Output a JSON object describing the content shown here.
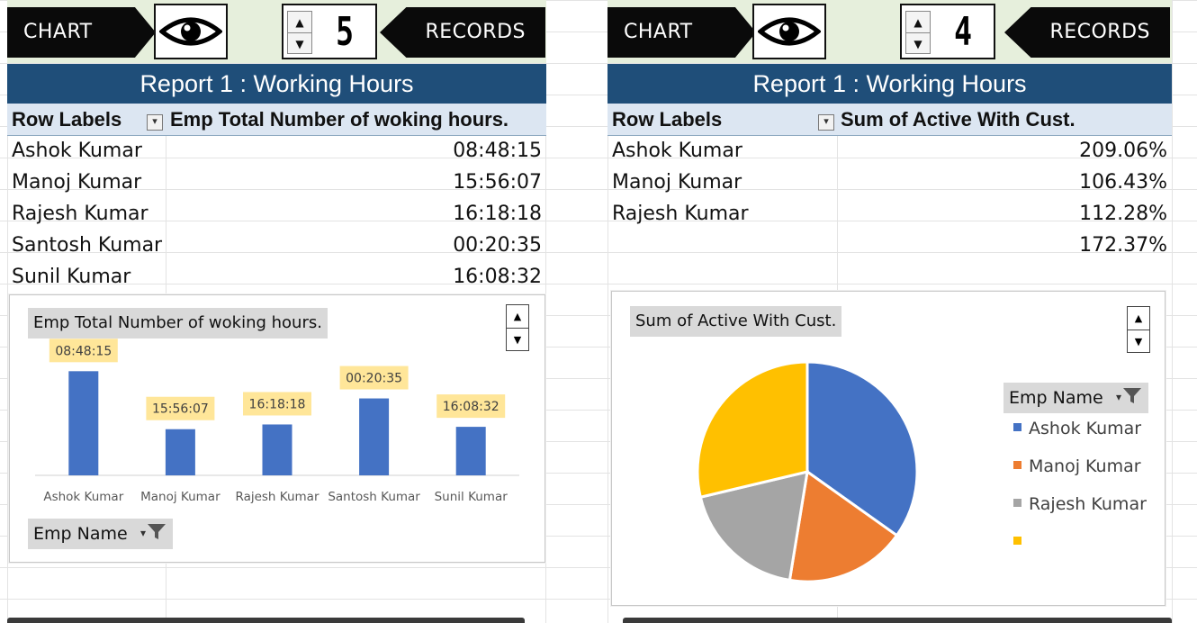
{
  "panels": [
    {
      "chart_label": "CHART",
      "records_count": "5",
      "records_label": "RECORDS",
      "report_title": "Report 1 : Working Hours",
      "row_labels_header": "Row Labels",
      "value_header": "Emp Total Number of woking hours.",
      "rows": [
        {
          "name": "Ashok Kumar",
          "value": "08:48:15"
        },
        {
          "name": "Manoj Kumar",
          "value": "15:56:07"
        },
        {
          "name": "Rajesh Kumar",
          "value": "16:18:18"
        },
        {
          "name": "Santosh Kumar",
          "value": "00:20:35"
        },
        {
          "name": "Sunil Kumar",
          "value": "16:08:32"
        }
      ],
      "chart_title_button": "Emp Total Number of woking hours.",
      "filter_button": "Emp Name"
    },
    {
      "chart_label": "CHART",
      "records_count": "4",
      "records_label": "RECORDS",
      "report_title": "Report 1 : Working Hours",
      "row_labels_header": "Row Labels",
      "value_header": "Sum of Active With Cust.",
      "rows": [
        {
          "name": "Ashok Kumar",
          "value": "209.06%"
        },
        {
          "name": "Manoj Kumar",
          "value": "106.43%"
        },
        {
          "name": "Rajesh Kumar",
          "value": "112.28%"
        },
        {
          "name": "",
          "value": "172.37%"
        }
      ],
      "chart_title_button": "Sum of Active With Cust.",
      "filter_button": "Emp Name"
    }
  ],
  "colors": {
    "title_bar": "#1f4e79",
    "header_fill": "#dce6f2",
    "bar": "#4472c4",
    "data_label_fill": "#ffe699",
    "slice_1": "#4472c4",
    "slice_2": "#ed7d31",
    "slice_3": "#a5a5a5",
    "slice_4": "#ffc000"
  },
  "chart_data": [
    {
      "type": "bar",
      "title": "Emp Total Number of woking hours.",
      "categories": [
        "Ashok Kumar",
        "Manoj Kumar",
        "Rajesh Kumar",
        "Santosh Kumar",
        "Sunil Kumar"
      ],
      "values": [
        8.8,
        3.9,
        4.3,
        6.5,
        4.1
      ],
      "data_labels": [
        "08:48:15",
        "15:56:07",
        "16:18:18",
        "00:20:35",
        "16:08:32"
      ],
      "grid": false,
      "legend": "none"
    },
    {
      "type": "pie",
      "title": "Sum of Active With Cust.",
      "categories": [
        "Ashok Kumar",
        "Manoj Kumar",
        "Rajesh Kumar",
        ""
      ],
      "values": [
        209.06,
        106.43,
        112.28,
        172.37
      ],
      "legend_title": "Emp Name",
      "legend": "right"
    }
  ]
}
